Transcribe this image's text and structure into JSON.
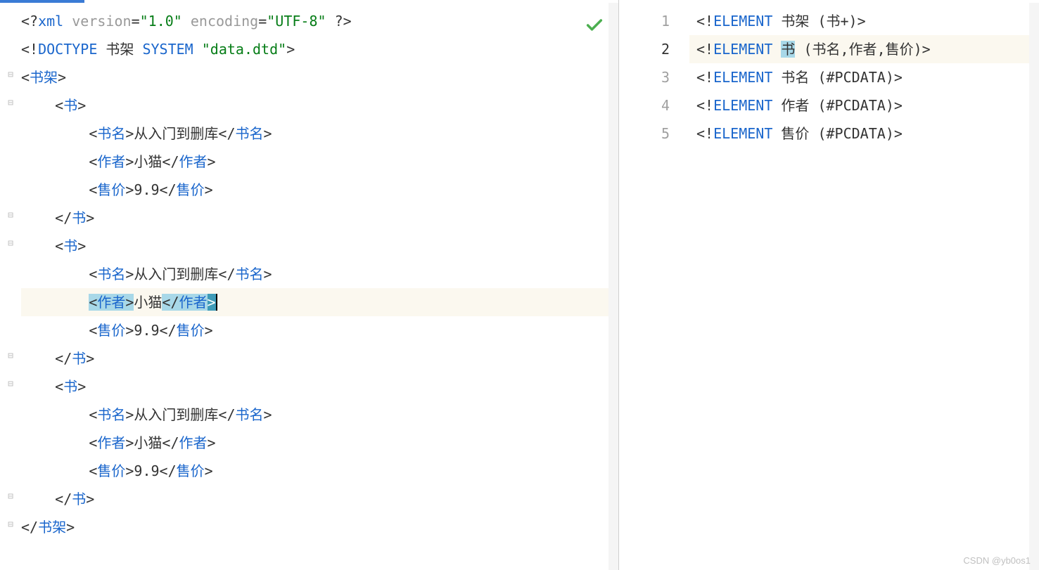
{
  "watermark": "CSDN @yb0os1",
  "left": {
    "lines": [
      {
        "indent": 0,
        "tokens": [
          {
            "t": "punct",
            "v": "<?"
          },
          {
            "t": "tag",
            "v": "xml "
          },
          {
            "t": "kw",
            "v": "version"
          },
          {
            "t": "punct",
            "v": "="
          },
          {
            "t": "str",
            "v": "\"1.0\""
          },
          {
            "t": "txt",
            "v": " "
          },
          {
            "t": "kw",
            "v": "encoding"
          },
          {
            "t": "punct",
            "v": "="
          },
          {
            "t": "str",
            "v": "\"UTF-8\""
          },
          {
            "t": "txt",
            "v": " "
          },
          {
            "t": "punct",
            "v": "?>"
          }
        ]
      },
      {
        "indent": 0,
        "tokens": [
          {
            "t": "punct",
            "v": "<!"
          },
          {
            "t": "tag",
            "v": "DOCTYPE "
          },
          {
            "t": "txt",
            "v": "书架 "
          },
          {
            "t": "tag",
            "v": "SYSTEM "
          },
          {
            "t": "str",
            "v": "\"data.dtd\""
          },
          {
            "t": "punct",
            "v": ">"
          }
        ]
      },
      {
        "indent": 0,
        "fold": "open",
        "tokens": [
          {
            "t": "punct",
            "v": "<"
          },
          {
            "t": "tag",
            "v": "书架"
          },
          {
            "t": "punct",
            "v": ">"
          }
        ]
      },
      {
        "indent": 1,
        "fold": "open",
        "tokens": [
          {
            "t": "punct",
            "v": "<"
          },
          {
            "t": "tag",
            "v": "书"
          },
          {
            "t": "punct",
            "v": ">"
          }
        ]
      },
      {
        "indent": 2,
        "tokens": [
          {
            "t": "punct",
            "v": "<"
          },
          {
            "t": "tag",
            "v": "书名"
          },
          {
            "t": "punct",
            "v": ">"
          },
          {
            "t": "txt",
            "v": "从入门到删库"
          },
          {
            "t": "punct",
            "v": "</"
          },
          {
            "t": "tag",
            "v": "书名"
          },
          {
            "t": "punct",
            "v": ">"
          }
        ]
      },
      {
        "indent": 2,
        "tokens": [
          {
            "t": "punct",
            "v": "<"
          },
          {
            "t": "tag",
            "v": "作者"
          },
          {
            "t": "punct",
            "v": ">"
          },
          {
            "t": "txt",
            "v": "小猫"
          },
          {
            "t": "punct",
            "v": "</"
          },
          {
            "t": "tag",
            "v": "作者"
          },
          {
            "t": "punct",
            "v": ">"
          }
        ]
      },
      {
        "indent": 2,
        "tokens": [
          {
            "t": "punct",
            "v": "<"
          },
          {
            "t": "tag",
            "v": "售价"
          },
          {
            "t": "punct",
            "v": ">"
          },
          {
            "t": "txt",
            "v": "9.9"
          },
          {
            "t": "punct",
            "v": "</"
          },
          {
            "t": "tag",
            "v": "售价"
          },
          {
            "t": "punct",
            "v": ">"
          }
        ]
      },
      {
        "indent": 1,
        "fold": "close",
        "tokens": [
          {
            "t": "punct",
            "v": "</"
          },
          {
            "t": "tag",
            "v": "书"
          },
          {
            "t": "punct",
            "v": ">"
          }
        ]
      },
      {
        "indent": 1,
        "fold": "open",
        "tokens": [
          {
            "t": "punct",
            "v": "<"
          },
          {
            "t": "tag",
            "v": "书"
          },
          {
            "t": "punct",
            "v": ">"
          }
        ]
      },
      {
        "indent": 2,
        "tokens": [
          {
            "t": "punct",
            "v": "<"
          },
          {
            "t": "tag",
            "v": "书名"
          },
          {
            "t": "punct",
            "v": ">"
          },
          {
            "t": "txt",
            "v": "从入门到删库"
          },
          {
            "t": "punct",
            "v": "</"
          },
          {
            "t": "tag",
            "v": "书名"
          },
          {
            "t": "punct",
            "v": ">"
          }
        ]
      },
      {
        "indent": 2,
        "hl": true,
        "cursor": true,
        "tokens": [
          {
            "t": "punct",
            "v": "<",
            "sel": "bg"
          },
          {
            "t": "tag",
            "v": "作者",
            "sel": "bg"
          },
          {
            "t": "punct",
            "v": ">",
            "sel": "bg"
          },
          {
            "t": "txt",
            "v": "小猫"
          },
          {
            "t": "punct",
            "v": "</",
            "sel": "bg"
          },
          {
            "t": "tag",
            "v": "作者",
            "sel": "bg"
          },
          {
            "t": "punct",
            "v": ">",
            "sel": "dark"
          }
        ]
      },
      {
        "indent": 2,
        "tokens": [
          {
            "t": "punct",
            "v": "<"
          },
          {
            "t": "tag",
            "v": "售价"
          },
          {
            "t": "punct",
            "v": ">"
          },
          {
            "t": "txt",
            "v": "9.9"
          },
          {
            "t": "punct",
            "v": "</"
          },
          {
            "t": "tag",
            "v": "售价"
          },
          {
            "t": "punct",
            "v": ">"
          }
        ]
      },
      {
        "indent": 1,
        "fold": "close",
        "tokens": [
          {
            "t": "punct",
            "v": "</"
          },
          {
            "t": "tag",
            "v": "书"
          },
          {
            "t": "punct",
            "v": ">"
          }
        ]
      },
      {
        "indent": 1,
        "fold": "open",
        "tokens": [
          {
            "t": "punct",
            "v": "<"
          },
          {
            "t": "tag",
            "v": "书"
          },
          {
            "t": "punct",
            "v": ">"
          }
        ]
      },
      {
        "indent": 2,
        "tokens": [
          {
            "t": "punct",
            "v": "<"
          },
          {
            "t": "tag",
            "v": "书名"
          },
          {
            "t": "punct",
            "v": ">"
          },
          {
            "t": "txt",
            "v": "从入门到删库"
          },
          {
            "t": "punct",
            "v": "</"
          },
          {
            "t": "tag",
            "v": "书名"
          },
          {
            "t": "punct",
            "v": ">"
          }
        ]
      },
      {
        "indent": 2,
        "tokens": [
          {
            "t": "punct",
            "v": "<"
          },
          {
            "t": "tag",
            "v": "作者"
          },
          {
            "t": "punct",
            "v": ">"
          },
          {
            "t": "txt",
            "v": "小猫"
          },
          {
            "t": "punct",
            "v": "</"
          },
          {
            "t": "tag",
            "v": "作者"
          },
          {
            "t": "punct",
            "v": ">"
          }
        ]
      },
      {
        "indent": 2,
        "tokens": [
          {
            "t": "punct",
            "v": "<"
          },
          {
            "t": "tag",
            "v": "售价"
          },
          {
            "t": "punct",
            "v": ">"
          },
          {
            "t": "txt",
            "v": "9.9"
          },
          {
            "t": "punct",
            "v": "</"
          },
          {
            "t": "tag",
            "v": "售价"
          },
          {
            "t": "punct",
            "v": ">"
          }
        ]
      },
      {
        "indent": 1,
        "fold": "close",
        "tokens": [
          {
            "t": "punct",
            "v": "</"
          },
          {
            "t": "tag",
            "v": "书"
          },
          {
            "t": "punct",
            "v": ">"
          }
        ]
      },
      {
        "indent": 0,
        "fold": "close",
        "tokens": [
          {
            "t": "punct",
            "v": "</"
          },
          {
            "t": "tag",
            "v": "书架"
          },
          {
            "t": "punct",
            "v": ">"
          }
        ]
      }
    ]
  },
  "right": {
    "activeLine": 2,
    "lines": [
      {
        "n": "1",
        "tokens": [
          {
            "t": "punct",
            "v": "<!"
          },
          {
            "t": "tag",
            "v": "ELEMENT "
          },
          {
            "t": "txt",
            "v": "书架 "
          },
          {
            "t": "punct",
            "v": "("
          },
          {
            "t": "txt",
            "v": "书"
          },
          {
            "t": "punct",
            "v": "+)>"
          }
        ]
      },
      {
        "n": "2",
        "hl": true,
        "tokens": [
          {
            "t": "punct",
            "v": "<!"
          },
          {
            "t": "tag",
            "v": "ELEMENT "
          },
          {
            "t": "txt",
            "v": "书",
            "sel": "bg"
          },
          {
            "t": "txt",
            "v": " "
          },
          {
            "t": "punct",
            "v": "("
          },
          {
            "t": "txt",
            "v": "书名"
          },
          {
            "t": "punct",
            "v": ","
          },
          {
            "t": "txt",
            "v": "作者"
          },
          {
            "t": "punct",
            "v": ","
          },
          {
            "t": "txt",
            "v": "售价"
          },
          {
            "t": "punct",
            "v": ")>"
          }
        ]
      },
      {
        "n": "3",
        "tokens": [
          {
            "t": "punct",
            "v": "<!"
          },
          {
            "t": "tag",
            "v": "ELEMENT "
          },
          {
            "t": "txt",
            "v": "书名 "
          },
          {
            "t": "punct",
            "v": "("
          },
          {
            "t": "txt",
            "v": "#PCDATA"
          },
          {
            "t": "punct",
            "v": ")>"
          }
        ]
      },
      {
        "n": "4",
        "tokens": [
          {
            "t": "punct",
            "v": "<!"
          },
          {
            "t": "tag",
            "v": "ELEMENT "
          },
          {
            "t": "txt",
            "v": "作者 "
          },
          {
            "t": "punct",
            "v": "("
          },
          {
            "t": "txt",
            "v": "#PCDATA"
          },
          {
            "t": "punct",
            "v": ")>"
          }
        ]
      },
      {
        "n": "5",
        "tokens": [
          {
            "t": "punct",
            "v": "<!"
          },
          {
            "t": "tag",
            "v": "ELEMENT "
          },
          {
            "t": "txt",
            "v": "售价 "
          },
          {
            "t": "punct",
            "v": "("
          },
          {
            "t": "txt",
            "v": "#PCDATA"
          },
          {
            "t": "punct",
            "v": ")>"
          }
        ]
      }
    ]
  }
}
